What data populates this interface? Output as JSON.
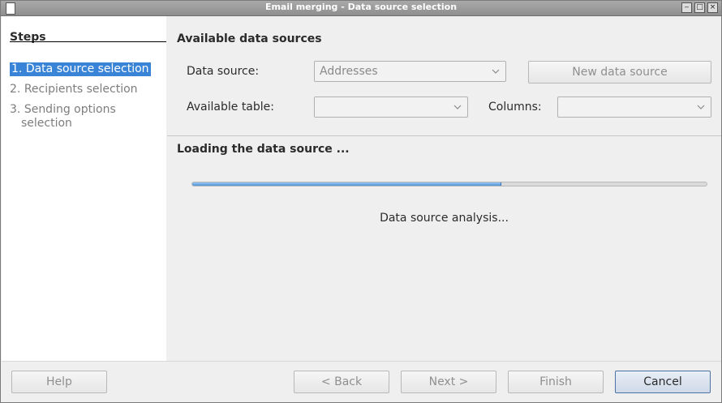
{
  "window": {
    "title": "Email merging - Data source selection",
    "controls": [
      "minimize-icon",
      "maximize-icon",
      "close-icon"
    ]
  },
  "steps": {
    "title": "Steps",
    "items": [
      {
        "number": "1.",
        "label": "Data source selection",
        "active": true
      },
      {
        "number": "2.",
        "label": "Recipients selection",
        "active": false
      },
      {
        "number": "3.",
        "label": "Sending options",
        "label2": "selection",
        "active": false
      }
    ]
  },
  "available": {
    "title": "Available data sources",
    "data_source_label": "Data source:",
    "data_source_value": "Addresses",
    "new_data_source": "New data source",
    "table_label": "Available table:",
    "table_value": "",
    "columns_label": "Columns:",
    "columns_value": ""
  },
  "loading": {
    "title": "Loading the data source ...",
    "progress": 0.6,
    "status": "Data source analysis..."
  },
  "footer": {
    "help": "Help",
    "back": "< Back",
    "next": "Next >",
    "finish": "Finish",
    "cancel": "Cancel"
  },
  "colors": {
    "accent": "#3a84d8",
    "progress": "#4e94d8"
  }
}
